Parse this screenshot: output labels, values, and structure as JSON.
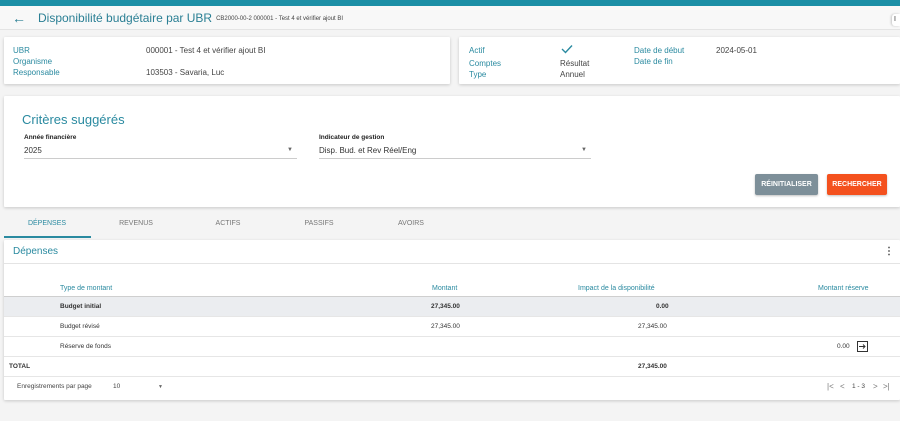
{
  "header": {
    "back_icon": "arrow-left-icon",
    "title": "Disponibilité budgétaire par UBR",
    "subtitle": "CB2000-00-2 000001 - Test 4 et vérifier ajout BI",
    "corner": "I"
  },
  "info_left": {
    "ubr_label": "UBR",
    "ubr_value": "000001 - Test 4 et vérifier ajout BI",
    "org_label": "Organisme",
    "resp_label": "Responsable",
    "resp_value": "103503 - Savaria, Luc"
  },
  "info_right": {
    "actif_label": "Actif",
    "comptes_label": "Comptes",
    "comptes_value": "Résultat",
    "type_label": "Type",
    "type_value": "Annuel",
    "debut_label": "Date de début",
    "debut_value": "2024-05-01",
    "fin_label": "Date de fin",
    "check_icon": "check-icon"
  },
  "criteria": {
    "title": "Critères suggérés",
    "year_label": "Année financière",
    "year_value": "2025",
    "indicator_label": "Indicateur de gestion",
    "indicator_value": "Disp. Bud. et Rev Réel/Eng",
    "reset_label": "RÉINITIALISER",
    "search_label": "RECHERCHER"
  },
  "tabs": [
    {
      "label": "DÉPENSES"
    },
    {
      "label": "REVENUS"
    },
    {
      "label": "ACTIFS"
    },
    {
      "label": "PASSIFS"
    },
    {
      "label": "AVOIRS"
    }
  ],
  "section": {
    "title": "Dépenses",
    "menu_icon": "more-vertical-icon"
  },
  "table": {
    "headers": {
      "type": "Type de montant",
      "montant": "Montant",
      "impact": "Impact de la disponibilité",
      "reserve": "Montant réserve"
    },
    "rows": [
      {
        "type": "Budget initial",
        "montant": "27,345.00",
        "impact": "0.00",
        "reserve": ""
      },
      {
        "type": "Budget révisé",
        "montant": "27,345.00",
        "impact": "27,345.00",
        "reserve": ""
      },
      {
        "type": "Réserve de fonds",
        "montant": "",
        "impact": "",
        "reserve": "0.00"
      }
    ],
    "total_label": "TOTAL",
    "total_impact": "27,345.00"
  },
  "footer": {
    "per_page_label": "Enregistrements par page",
    "per_page_value": "10",
    "range": "1 - 3"
  },
  "colors": {
    "accent": "#2a8aa0",
    "reset_btn": "#7d8f99",
    "search_btn": "#f4511e"
  }
}
